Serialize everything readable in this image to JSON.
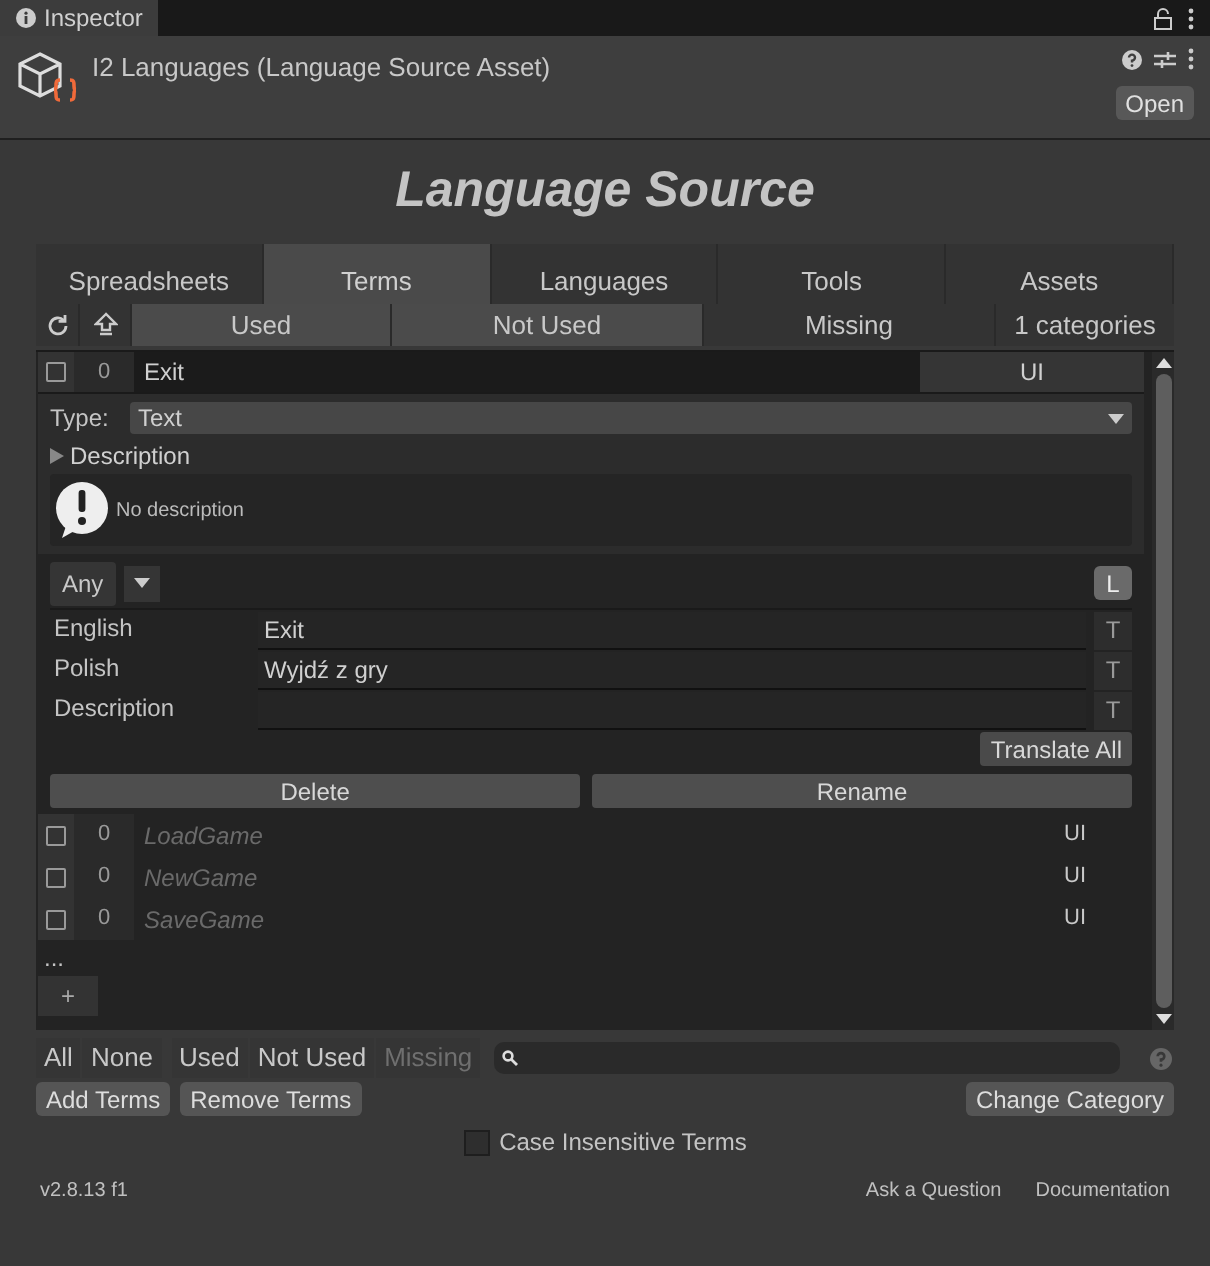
{
  "window_tabs": [
    {
      "label": "Inspector",
      "selected": true
    }
  ],
  "asset": {
    "title": "I2 Languages (Language Source Asset)",
    "open_button": "Open"
  },
  "heading": "Language Source",
  "tabs": [
    {
      "label": "Spreadsheets",
      "selected": false
    },
    {
      "label": "Terms",
      "selected": true
    },
    {
      "label": "Languages",
      "selected": false
    },
    {
      "label": "Tools",
      "selected": false
    },
    {
      "label": "Assets",
      "selected": false
    }
  ],
  "filters": [
    {
      "label": "Used",
      "selected": true
    },
    {
      "label": "Not Used",
      "selected": true
    },
    {
      "label": "Missing",
      "selected": false
    }
  ],
  "categories_button": "1 categories",
  "expanded_term": {
    "checked": false,
    "usage": "0",
    "name": "Exit",
    "category": "UI",
    "type_label": "Type:",
    "type": "Text",
    "description_toggle": {
      "label": "Description",
      "expanded": false
    },
    "message": "No description",
    "language_filter": "Any",
    "l_button": "L",
    "translations": [
      {
        "language": "English",
        "value": "Exit",
        "button": "T"
      },
      {
        "language": "Polish",
        "value": "Wyjdź z gry",
        "button": "T"
      },
      {
        "language": "Description",
        "button": "T"
      }
    ],
    "translate_all": "Translate All",
    "delete": "Delete",
    "rename": "Rename"
  },
  "terms": [
    {
      "checked": false,
      "usage": "0",
      "name": "LoadGame",
      "category": "UI"
    },
    {
      "checked": false,
      "usage": "0",
      "name": "NewGame",
      "category": "UI"
    },
    {
      "checked": false,
      "usage": "0",
      "name": "SaveGame",
      "category": "UI"
    }
  ],
  "more": "...",
  "add_button": "+",
  "select_buttons": [
    {
      "label": "All",
      "disabled": false
    },
    {
      "label": "None",
      "disabled": false
    },
    {
      "label": "Used",
      "disabled": false
    },
    {
      "label": "Not Used",
      "disabled": false
    },
    {
      "label": "Missing",
      "disabled": true
    }
  ],
  "actions": {
    "add_terms": "Add Terms",
    "remove_terms": "Remove Terms",
    "change_category": "Change Category"
  },
  "case_insensitive": {
    "label": "Case Insensitive Terms",
    "checked": false
  },
  "footer": {
    "version": "v2.8.13 f1",
    "links": [
      "Ask a Question",
      "Documentation"
    ]
  }
}
